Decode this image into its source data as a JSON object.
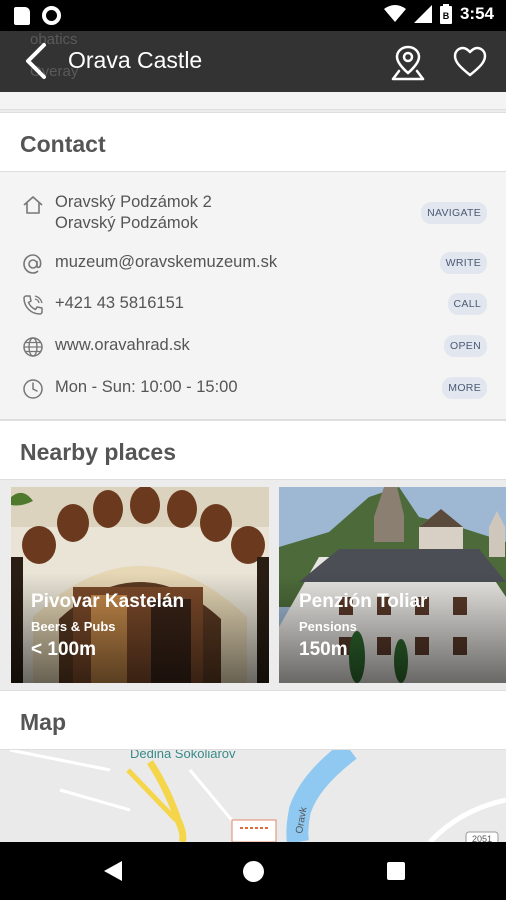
{
  "status_bar": {
    "time": "3:54"
  },
  "app_bar": {
    "title": "Orava Castle",
    "ghost_lines": [
      "obatics",
      "Overay"
    ]
  },
  "contact": {
    "title": "Contact",
    "address_line1": "Oravský Podzámok 2",
    "address_line2": "Oravský Podzámok",
    "navigate_label": "NAVIGATE",
    "email": "muzeum@oravskemuzeum.sk",
    "write_label": "WRITE",
    "phone": "+421 43 5816151",
    "call_label": "CALL",
    "website": "www.oravahrad.sk",
    "open_label": "OPEN",
    "hours": "Mon - Sun: 10:00 - 15:00",
    "more_label": "MORE"
  },
  "nearby": {
    "title": "Nearby places",
    "places": [
      {
        "name": "Pivovar Kastelán",
        "category": "Beers & Pubs",
        "distance": "< 100m"
      },
      {
        "name": "Penzión Toliar",
        "category": "Pensions",
        "distance": "150m"
      }
    ]
  },
  "map": {
    "title": "Map",
    "label": "Dedina Sokoliarov",
    "road_label": "Oravk",
    "badge_label": "2051"
  },
  "colors": {
    "app_bar": "#333333",
    "action_chip_bg": "#e2e6ee",
    "action_chip_text": "#4a5a75",
    "section_title": "#555555",
    "river": "#8fc8f0",
    "road": "#f5d54a"
  }
}
